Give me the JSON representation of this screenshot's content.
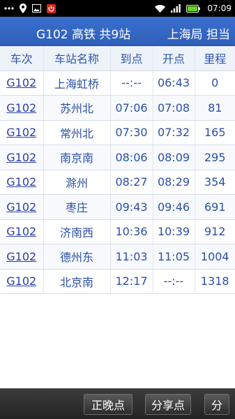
{
  "status_bar": {
    "time": "07:09",
    "icons": [
      "more-dots-icon",
      "location-icon",
      "image-icon",
      "power-icon",
      "wifi-icon",
      "signal-icon",
      "battery-icon"
    ]
  },
  "title_bar": {
    "left": "G102 高铁 共9站",
    "right": "上海局 担当"
  },
  "table": {
    "headers": [
      "车次",
      "车站名称",
      "到点",
      "开点",
      "里程"
    ],
    "rows": [
      {
        "train": "G102",
        "station": "上海虹桥",
        "arrive": "--:--",
        "depart": "06:43",
        "distance": "0"
      },
      {
        "train": "G102",
        "station": "苏州北",
        "arrive": "07:06",
        "depart": "07:08",
        "distance": "81"
      },
      {
        "train": "G102",
        "station": "常州北",
        "arrive": "07:30",
        "depart": "07:32",
        "distance": "165"
      },
      {
        "train": "G102",
        "station": "南京南",
        "arrive": "08:06",
        "depart": "08:09",
        "distance": "295"
      },
      {
        "train": "G102",
        "station": "滁州",
        "arrive": "08:27",
        "depart": "08:29",
        "distance": "354"
      },
      {
        "train": "G102",
        "station": "枣庄",
        "arrive": "09:43",
        "depart": "09:46",
        "distance": "691"
      },
      {
        "train": "G102",
        "station": "济南西",
        "arrive": "10:36",
        "depart": "10:39",
        "distance": "912"
      },
      {
        "train": "G102",
        "station": "德州东",
        "arrive": "11:03",
        "depart": "11:05",
        "distance": "1004"
      },
      {
        "train": "G102",
        "station": "北京南",
        "arrive": "12:17",
        "depart": "--:--",
        "distance": "1318"
      }
    ]
  },
  "bottom_bar": {
    "late_button": "正晚点",
    "share_button": "分享点",
    "more_button": "分"
  },
  "colors": {
    "title_bar": "#3366cc",
    "header_text": "#2d56ad",
    "cell_text": "#2b4fa6",
    "link": "#2c3ea7",
    "bottom_bar": "#2a2a2a"
  }
}
